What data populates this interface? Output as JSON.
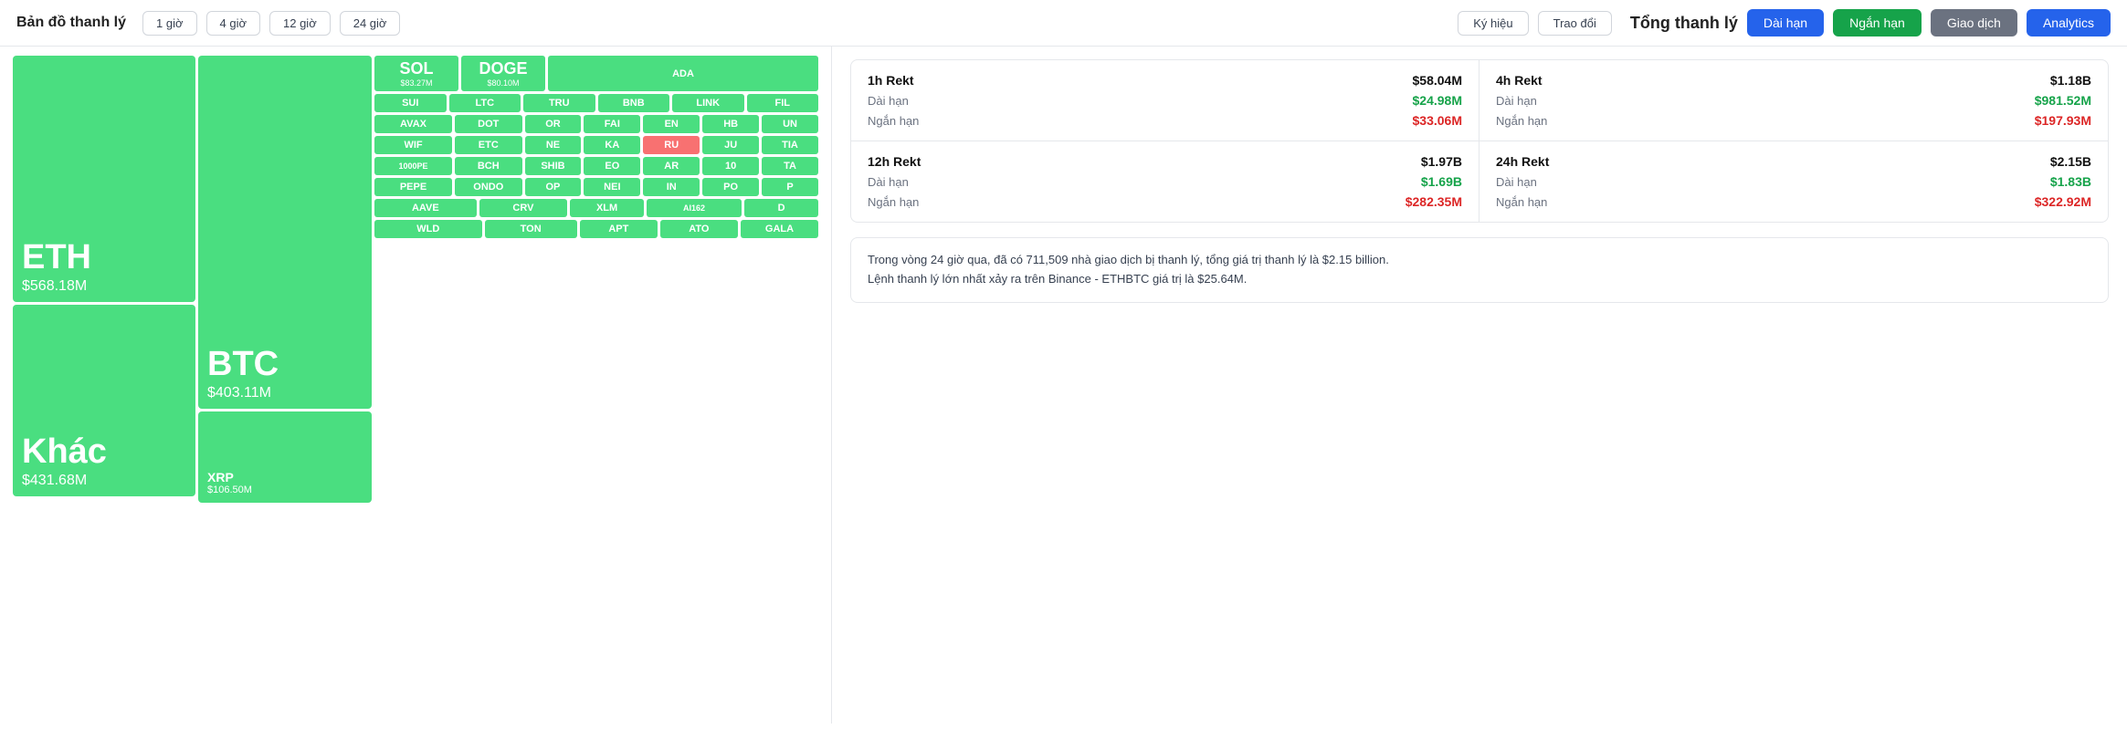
{
  "topbar": {
    "title": "Bản đồ thanh lý",
    "time_options": [
      "1 giờ",
      "4 giờ",
      "12 giờ",
      "24 giờ"
    ],
    "toggle_symbol": "Ký hiệu",
    "toggle_exchange": "Trao đổi",
    "section_title": "Tổng thanh lý",
    "btn_dai_han": "Dài hạn",
    "btn_ngan_han": "Ngắn hạn",
    "btn_giao_dich": "Giao dịch",
    "btn_analytics": "Analytics"
  },
  "treemap": {
    "eth": {
      "label": "ETH",
      "value": "$568.18M"
    },
    "khac": {
      "label": "Khác",
      "value": "$431.68M"
    },
    "btc": {
      "label": "BTC",
      "value": "$403.11M"
    },
    "xrp": {
      "label": "XRP",
      "value": "$106.50M"
    },
    "sol": {
      "label": "SOL",
      "value": "$83.27M"
    },
    "doge": {
      "label": "DOGE",
      "value": "$80.10M"
    },
    "ada": {
      "label": "ADA",
      "value": ""
    },
    "sui": {
      "label": "SUI",
      "value": ""
    },
    "ltc": {
      "label": "LTC",
      "value": ""
    },
    "tru": {
      "label": "TRU",
      "value": ""
    },
    "bnb": {
      "label": "BNB",
      "value": ""
    },
    "link": {
      "label": "LINK",
      "value": ""
    },
    "fil": {
      "label": "FIL",
      "value": ""
    },
    "avax": {
      "label": "AVAX",
      "value": ""
    },
    "dot": {
      "label": "DOT",
      "value": ""
    },
    "or": {
      "label": "OR",
      "value": ""
    },
    "fai": {
      "label": "FAI",
      "value": ""
    },
    "en": {
      "label": "EN",
      "value": ""
    },
    "hb": {
      "label": "HB",
      "value": ""
    },
    "un": {
      "label": "UN",
      "value": ""
    },
    "wif": {
      "label": "WIF",
      "value": ""
    },
    "etc": {
      "label": "ETC",
      "value": ""
    },
    "ne": {
      "label": "NE",
      "value": ""
    },
    "ka": {
      "label": "KA",
      "value": ""
    },
    "ru": {
      "label": "RU",
      "value": ""
    },
    "ju": {
      "label": "JU",
      "value": ""
    },
    "tia": {
      "label": "TIA",
      "value": ""
    },
    "1000pe": {
      "label": "1000PE",
      "value": ""
    },
    "bch": {
      "label": "BCH",
      "value": ""
    },
    "shib": {
      "label": "SHIB",
      "value": ""
    },
    "eo": {
      "label": "EO",
      "value": ""
    },
    "ar": {
      "label": "AR",
      "value": ""
    },
    "10": {
      "label": "10",
      "value": ""
    },
    "ta": {
      "label": "TA",
      "value": ""
    },
    "pepe": {
      "label": "PEPE",
      "value": ""
    },
    "ondo": {
      "label": "ONDO",
      "value": ""
    },
    "op": {
      "label": "OP",
      "value": ""
    },
    "nei": {
      "label": "NEI",
      "value": ""
    },
    "in": {
      "label": "IN",
      "value": ""
    },
    "po": {
      "label": "PO",
      "value": ""
    },
    "p": {
      "label": "P",
      "value": ""
    },
    "aave": {
      "label": "AAVE",
      "value": ""
    },
    "crv": {
      "label": "CRV",
      "value": ""
    },
    "xlm": {
      "label": "XLM",
      "value": ""
    },
    "ai162": {
      "label": "AI162",
      "value": ""
    },
    "d": {
      "label": "D",
      "value": ""
    },
    "wld": {
      "label": "WLD",
      "value": ""
    },
    "ton": {
      "label": "TON",
      "value": ""
    },
    "apt": {
      "label": "APT",
      "value": ""
    },
    "ato": {
      "label": "ATO",
      "value": ""
    },
    "gala": {
      "label": "GALA",
      "value": ""
    }
  },
  "stats": {
    "1h": {
      "title": "1h Rekt",
      "total": "$58.04M",
      "dai_han_label": "Dài hạn",
      "dai_han_value": "$24.98M",
      "ngan_han_label": "Ngắn hạn",
      "ngan_han_value": "$33.06M"
    },
    "4h": {
      "title": "4h Rekt",
      "total": "$1.18B",
      "dai_han_label": "Dài hạn",
      "dai_han_value": "$981.52M",
      "ngan_han_label": "Ngắn hạn",
      "ngan_han_value": "$197.93M"
    },
    "12h": {
      "title": "12h Rekt",
      "total": "$1.97B",
      "dai_han_label": "Dài hạn",
      "dai_han_value": "$1.69B",
      "ngan_han_label": "Ngắn hạn",
      "ngan_han_value": "$282.35M"
    },
    "24h": {
      "title": "24h Rekt",
      "total": "$2.15B",
      "dai_han_label": "Dài hạn",
      "dai_han_value": "$1.83B",
      "ngan_han_label": "Ngắn hạn",
      "ngan_han_value": "$322.92M"
    }
  },
  "info": {
    "line1": "Trong vòng 24 giờ qua, đã có 711,509 nhà giao dịch bị thanh lý, tổng giá trị thanh lý là $2.15 billion.",
    "line2": "Lệnh thanh lý lớn nhất xảy ra trên Binance - ETHBTC giá trị là $25.64M."
  }
}
